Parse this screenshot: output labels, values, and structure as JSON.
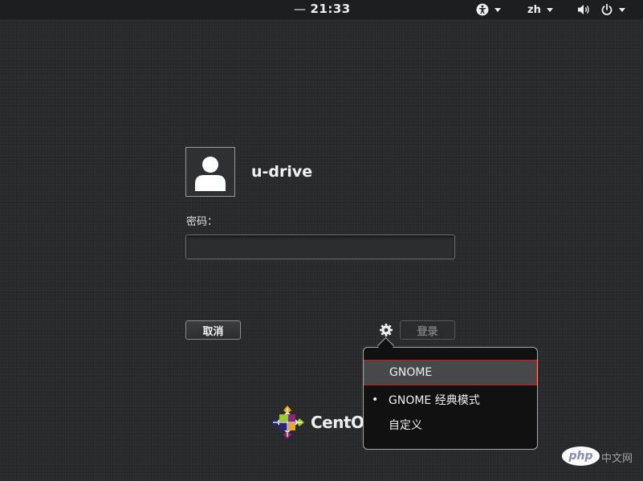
{
  "topbar": {
    "clock": "21:33",
    "language": "zh",
    "icons": [
      "accessibility-icon",
      "volume-icon",
      "power-icon"
    ]
  },
  "user": {
    "name": "u-drive",
    "password_label": "密码：",
    "password_value": ""
  },
  "buttons": {
    "cancel": "取消",
    "login": "登录"
  },
  "session_menu": {
    "items": [
      {
        "label": "GNOME",
        "selected": false,
        "highlighted": true
      },
      {
        "label": "GNOME 经典模式",
        "selected": true,
        "highlighted": false
      },
      {
        "label": "自定义",
        "selected": false,
        "highlighted": false
      }
    ],
    "bullet": "•"
  },
  "branding": {
    "distro_text": "CentOS",
    "watermark_logo": "php",
    "watermark_text": "中文网"
  },
  "colors": {
    "background": "#2b2c2e",
    "topbar": "#1d1e1f",
    "menu_highlight": "#474849",
    "highlight_outline": "#c51b1b"
  }
}
